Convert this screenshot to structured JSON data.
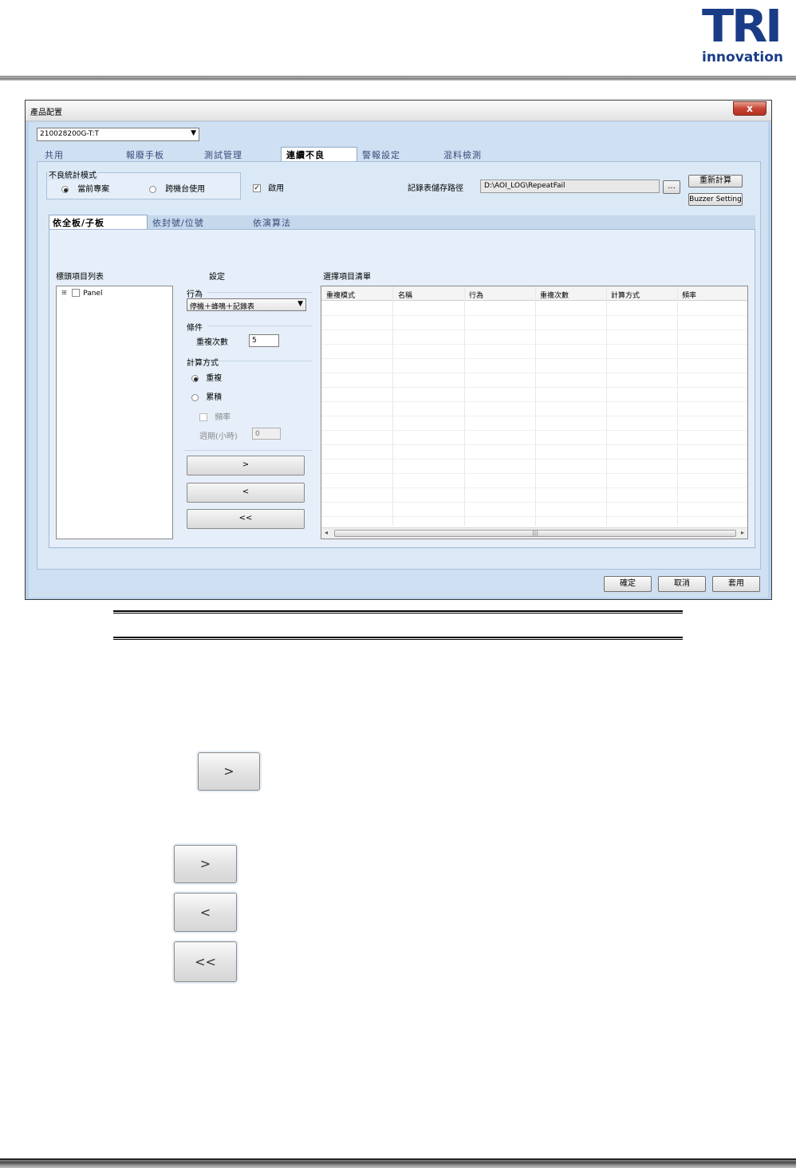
{
  "logo": {
    "main": "TRI",
    "sub": "innovation"
  },
  "window": {
    "title": "產品配置",
    "close_glyph": "x",
    "product_combo": {
      "value": "210028200G-T:T"
    },
    "tabs": [
      "共用",
      "報廢手板",
      "測試管理",
      "連續不良",
      "警報設定",
      "混料檢測"
    ],
    "active_tab": "連續不良",
    "stat_mode": {
      "title": "不良統計模式",
      "option1": "當前專案",
      "option2": "跨機台使用",
      "selected": "當前專案"
    },
    "enable": {
      "label": "啟用",
      "checked": true
    },
    "log_path": {
      "label": "記錄表儲存路徑",
      "value": "D:\\AOI_LOG\\RepeatFail",
      "browse_label": "..."
    },
    "recalc_button": "重新計算",
    "buzzer_button": "Buzzer Setting",
    "subtabs": [
      "依全板/子板",
      "依封號/位號",
      "依演算法"
    ],
    "item_list": {
      "title": "標頭項目列表",
      "expander": "⊞",
      "root": "Panel"
    },
    "settings": {
      "title": "設定",
      "behavior_section": "行為",
      "behavior_value": "停機＋蜂鳴＋記錄表",
      "condition_section": "條件",
      "repeat_count_label": "重複次數",
      "repeat_count_value": "5",
      "calc_section": "計算方式",
      "calc_repeat": "重複",
      "calc_accum": "累積",
      "frequency_label": "頻率",
      "period_label": "週期(小時)",
      "period_value": "0",
      "add_button": ">",
      "remove_button": "<",
      "remove_all_button": "<<"
    },
    "selected_list": {
      "title": "選擇項目清單",
      "columns": [
        "重複模式",
        "名稱",
        "行為",
        "重複次數",
        "計算方式",
        "頻率"
      ],
      "scroll_left": "◂",
      "scroll_right": "▸",
      "thumb": "|||"
    },
    "footer": {
      "ok": "確定",
      "cancel": "取消",
      "apply": "套用"
    }
  },
  "zoom_buttons": {
    "single": ">",
    "add": ">",
    "remove": "<",
    "remove_all": "<<"
  }
}
